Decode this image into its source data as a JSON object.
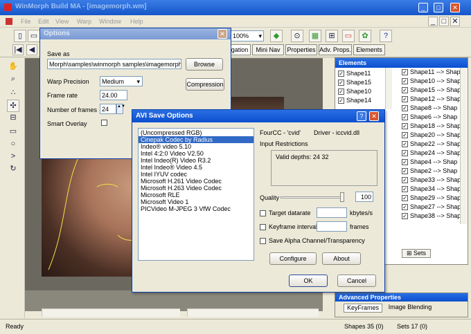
{
  "app": {
    "title": "WinMorph Build MA - [imagemorph.wm]",
    "menus": [
      "File",
      "Edit",
      "View",
      "Warp",
      "Window",
      "Help"
    ],
    "zoom": "100%"
  },
  "tabs": [
    "gation",
    "Mini Nav",
    "Properties",
    "Adv. Props.",
    "Elements"
  ],
  "elements_panel": {
    "title": "Elements",
    "left_items": [
      "Shape11",
      "Shape15",
      "Shape10",
      "Shape14"
    ],
    "right_items": [
      "Shape11 --> Shap",
      "Shape10 --> Shap",
      "Shape15 --> Shap",
      "Shape12 --> Shap",
      "Shape8 --> Shap",
      "Shape6 --> Shap",
      "Shape18 --> Shap",
      "Shape20 --> Shap",
      "Shape22 --> Shap",
      "Shape24 --> Shap",
      "Shape4 --> Shap",
      "Shape2 --> Shap",
      "Shape33 --> Shap",
      "Shape34 --> Shap",
      "Shape29 --> Shap",
      "Shape27 --> Shap",
      "Shape38 --> Shap"
    ],
    "sets_tab": "Sets"
  },
  "adv_panel": {
    "title": "Advanced Properties",
    "tab_keyframes": "KeyFrames",
    "tab_blending": "Image Blending"
  },
  "options_dialog": {
    "title": "Options",
    "save_as_label": "Save as",
    "save_path": "Morph\\samples\\winmorph samples\\imagemorph.avi",
    "browse": "Browse",
    "warp_label": "Warp Precision",
    "warp_value": "Medium",
    "compression": "Compression",
    "framerate_label": "Frame rate",
    "framerate_value": "24.00",
    "frames_label": "Number of frames",
    "frames_value": "24",
    "smart_overlay": "Smart Overlay"
  },
  "avi_dialog": {
    "title": "AVI Save Options",
    "codecs": [
      "(Uncompressed RGB)",
      "Cinepak Codec by Radius",
      "Indeo® video 5.10",
      "Intel 4:2:0 Video V2.50",
      "Intel Indeo(R) Video R3.2",
      "Intel Indeo® Video 4.5",
      "Intel IYUV codec",
      "Microsoft H.261 Video Codec",
      "Microsoft H.263 Video Codec",
      "Microsoft RLE",
      "Microsoft Video 1",
      "PICVideo M-JPEG 3 VfW Codec"
    ],
    "fourcc": "FourCC -  'cvid'",
    "driver": "Driver -  iccvid.dll",
    "input_restrictions": "Input Restrictions",
    "valid_depths": "Valid depths: 24 32",
    "quality_label": "Quality",
    "quality_value": "100",
    "quality_level": 1.0,
    "target_datarate": "Target datarate",
    "kbytes": "kbytes/s",
    "keyframe_interval": "Keyframe interval",
    "frames": "frames",
    "save_alpha": "Save Alpha Channel/Transparency",
    "configure": "Configure",
    "about": "About",
    "ok": "OK",
    "cancel": "Cancel"
  },
  "status": {
    "ready": "Ready",
    "shapes": "Shapes 35 (0)",
    "sets": "Sets 17 (0)"
  }
}
